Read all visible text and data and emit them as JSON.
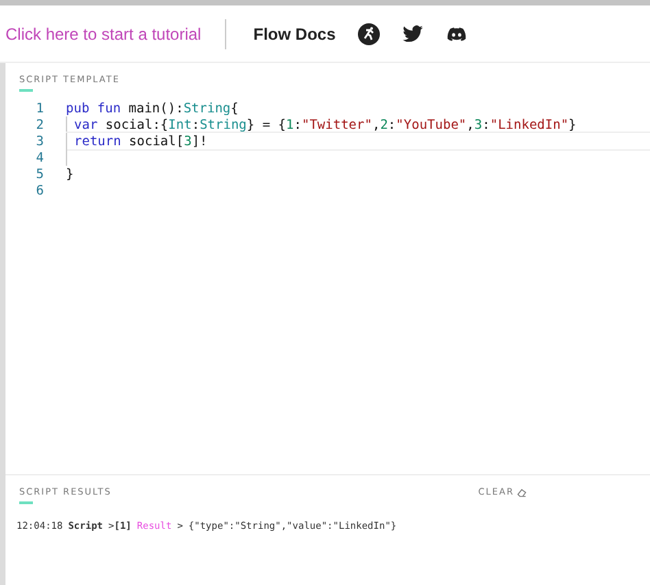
{
  "header": {
    "tutorial_link": "Click here to start a tutorial",
    "docs_link": "Flow Docs"
  },
  "editor": {
    "title": "SCRIPT TEMPLATE",
    "lines": [
      {
        "number": "1",
        "indented": false,
        "active": false,
        "tokens": [
          {
            "kind": "keyword",
            "text": "pub fun"
          },
          {
            "kind": "plain",
            "text": " main():"
          },
          {
            "kind": "type",
            "text": "String"
          },
          {
            "kind": "plain",
            "text": "{"
          }
        ]
      },
      {
        "number": "2",
        "indented": true,
        "active": false,
        "tokens": [
          {
            "kind": "keyword",
            "text": "var"
          },
          {
            "kind": "plain",
            "text": " social:{"
          },
          {
            "kind": "type",
            "text": "Int"
          },
          {
            "kind": "plain",
            "text": ":"
          },
          {
            "kind": "type",
            "text": "String"
          },
          {
            "kind": "plain",
            "text": "} = {"
          },
          {
            "kind": "number",
            "text": "1"
          },
          {
            "kind": "plain",
            "text": ":"
          },
          {
            "kind": "string",
            "text": "\"Twitter\""
          },
          {
            "kind": "plain",
            "text": ","
          },
          {
            "kind": "number",
            "text": "2"
          },
          {
            "kind": "plain",
            "text": ":"
          },
          {
            "kind": "string",
            "text": "\"YouTube\""
          },
          {
            "kind": "plain",
            "text": ","
          },
          {
            "kind": "number",
            "text": "3"
          },
          {
            "kind": "plain",
            "text": ":"
          },
          {
            "kind": "string",
            "text": "\"LinkedIn\""
          },
          {
            "kind": "plain",
            "text": "}"
          }
        ]
      },
      {
        "number": "3",
        "indented": true,
        "active": true,
        "tokens": [
          {
            "kind": "keyword",
            "text": "return"
          },
          {
            "kind": "plain",
            "text": " social["
          },
          {
            "kind": "number",
            "text": "3"
          },
          {
            "kind": "plain",
            "text": "]!"
          }
        ]
      },
      {
        "number": "4",
        "indented": true,
        "active": false
      },
      {
        "number": "5",
        "indented": false,
        "active": false,
        "tokens": [
          {
            "kind": "plain",
            "text": "}"
          }
        ]
      },
      {
        "number": "6",
        "indented": false,
        "active": false
      }
    ]
  },
  "results": {
    "title": "SCRIPT RESULTS",
    "clear": "CLEAR",
    "entries": [
      {
        "time": "12:04:18",
        "source": "Script",
        "arrow1": ">",
        "index": "[1]",
        "label": "Result",
        "arrow2": ">",
        "value": "{\"type\":\"String\",\"value\":\"LinkedIn\"}"
      }
    ]
  }
}
